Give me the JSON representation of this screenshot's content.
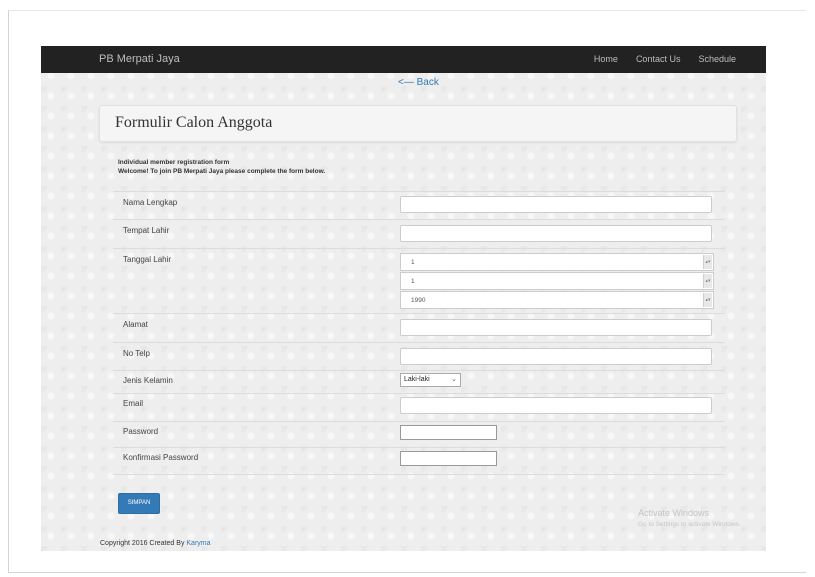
{
  "navbar": {
    "brand": "PB Merpati Jaya",
    "links": [
      {
        "label": "Home"
      },
      {
        "label": "Contact Us"
      },
      {
        "label": "Schedule"
      }
    ]
  },
  "back_link": "<— Back",
  "header": {
    "title": "Formulir Calon Anggota"
  },
  "intro": {
    "line1": "Individual member registration form",
    "line2": "Welcome! To join PB Merpati Jaya please complete the form below."
  },
  "form": {
    "full_name_label": "Nama Lengkap",
    "birthplace_label": "Tempat Lahir",
    "birthdate_label": "Tanggal Lahir",
    "birth_day": "1",
    "birth_month": "1",
    "birth_year": "1990",
    "address_label": "Alamat",
    "phone_label": "No Telp",
    "gender_label": "Jenis Kelamin",
    "gender_value": "Laki-laki",
    "email_label": "Email",
    "password_label": "Password",
    "confirm_password_label": "Konfirmasi Password",
    "submit_label": "SIMPAN"
  },
  "watermark": {
    "title": "Activate Windows",
    "subtitle": "Go to Settings to activate Windows."
  },
  "footer": {
    "text": "Copyright 2016 Created By",
    "author": "Karyma"
  }
}
